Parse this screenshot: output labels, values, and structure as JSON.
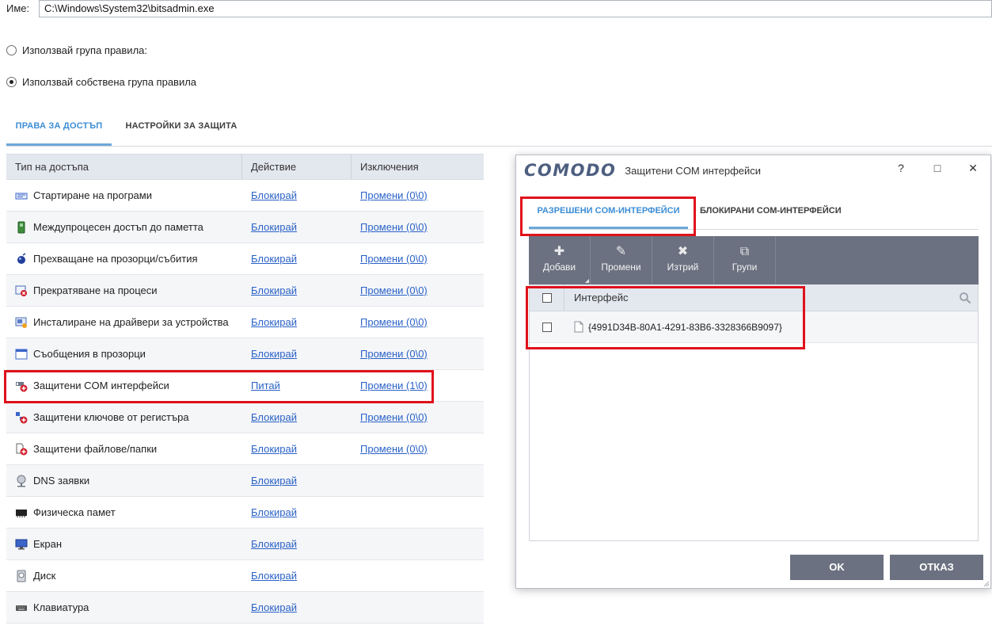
{
  "name_field": {
    "label": "Име:",
    "value": "C:\\Windows\\System32\\bitsadmin.exe"
  },
  "ruleset_options": [
    {
      "label": "Използвай група правила:",
      "selected": false
    },
    {
      "label": "Използвай собствена група правила",
      "selected": true
    }
  ],
  "main_tabs": [
    {
      "label": "ПРАВА ЗА ДОСТЪП",
      "active": true
    },
    {
      "label": "НАСТРОЙКИ ЗА ЗАЩИТА",
      "active": false
    }
  ],
  "access_table": {
    "headers": [
      "Тип на достъпа",
      "Действие",
      "Изключения"
    ],
    "rows": [
      {
        "name": "Стартиране на програми",
        "icon": "run-programs-icon",
        "action": "Блокирай",
        "exceptions": "Промени (0\\0)"
      },
      {
        "name": "Междупроцесен достъп до паметта",
        "icon": "memory-access-icon",
        "action": "Блокирай",
        "exceptions": "Промени (0\\0)"
      },
      {
        "name": "Прехващане на прозорци/събития",
        "icon": "window-hook-icon",
        "action": "Блокирай",
        "exceptions": "Промени (0\\0)"
      },
      {
        "name": "Прекратяване на процеси",
        "icon": "terminate-process-icon",
        "action": "Блокирай",
        "exceptions": "Промени (0\\0)"
      },
      {
        "name": "Инсталиране на драйвери за устройства",
        "icon": "driver-install-icon",
        "action": "Блокирай",
        "exceptions": "Промени (0\\0)"
      },
      {
        "name": "Съобщения в прозорци",
        "icon": "window-messages-icon",
        "action": "Блокирай",
        "exceptions": "Промени (0\\0)"
      },
      {
        "name": "Защитени COM интерфейси",
        "icon": "com-interfaces-icon",
        "action": "Питай",
        "exceptions": "Промени (1\\0)"
      },
      {
        "name": "Защитени ключове от регистъра",
        "icon": "registry-keys-icon",
        "action": "Блокирай",
        "exceptions": "Промени (0\\0)"
      },
      {
        "name": "Защитени файлове/папки",
        "icon": "protected-files-icon",
        "action": "Блокирай",
        "exceptions": "Промени (0\\0)"
      },
      {
        "name": "DNS заявки",
        "icon": "dns-requests-icon",
        "action": "Блокирай",
        "exceptions": ""
      },
      {
        "name": "Физическа памет",
        "icon": "physical-memory-icon",
        "action": "Блокирай",
        "exceptions": ""
      },
      {
        "name": "Екран",
        "icon": "screen-icon",
        "action": "Блокирай",
        "exceptions": ""
      },
      {
        "name": "Диск",
        "icon": "disk-icon",
        "action": "Блокирай",
        "exceptions": ""
      },
      {
        "name": "Клавиатура",
        "icon": "keyboard-icon",
        "action": "Блокирай",
        "exceptions": ""
      }
    ]
  },
  "dialog": {
    "logo": "COMODO",
    "title": "Защитени COM интерфейси",
    "controls": {
      "help": "?",
      "maximize": "□",
      "close": "✕"
    },
    "tabs": [
      {
        "label": "РАЗРЕШЕНИ COM-ИНТЕРФЕЙСИ",
        "active": true
      },
      {
        "label": "БЛОКИРАНИ COM-ИНТЕРФЕЙСИ",
        "active": false
      }
    ],
    "toolbar": [
      {
        "label": "Добави",
        "icon": "plus-icon",
        "glyph": "✚"
      },
      {
        "label": "Промени",
        "icon": "pencil-icon",
        "glyph": "✎"
      },
      {
        "label": "Изтрий",
        "icon": "delete-x-icon",
        "glyph": "✖"
      },
      {
        "label": "Групи",
        "icon": "groups-icon",
        "glyph": "⧉"
      }
    ],
    "grid": {
      "column": "Интерфейс",
      "rows": [
        {
          "value": "{4991D34B-80A1-4291-83B6-3328366B9097}"
        }
      ]
    },
    "buttons": {
      "ok": "OK",
      "cancel": "ОТКАЗ"
    }
  },
  "colors": {
    "accent": "#3c8dd4",
    "highlight": "#e0111b",
    "toolbar": "#6b7180",
    "link": "#2a62c7"
  }
}
